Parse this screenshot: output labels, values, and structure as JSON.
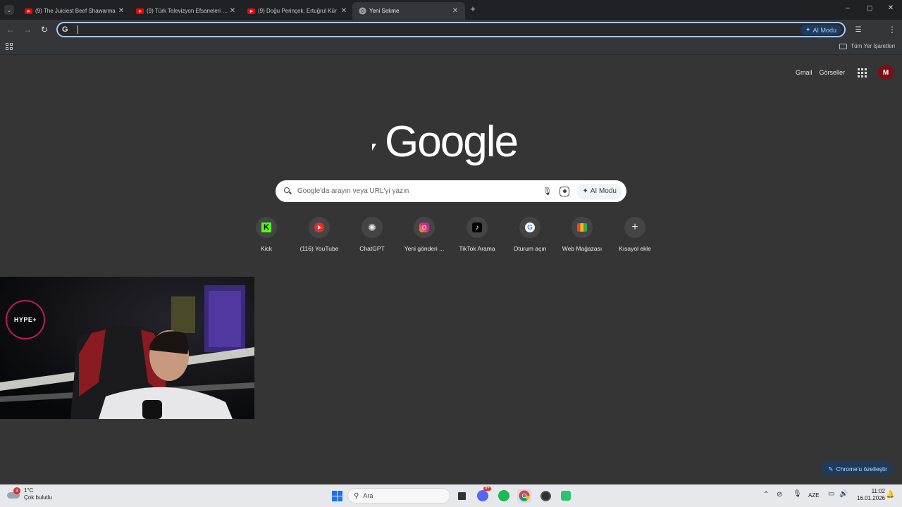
{
  "tabs": [
    {
      "title": "(9) The Juiciest Beef Shawarma",
      "favicon": "youtube-icon",
      "active": false
    },
    {
      "title": "(9) Türk Televizyon Efsaneleri Sp",
      "favicon": "youtube-icon",
      "active": false
    },
    {
      "title": "(9) Doğu Perinçek, Ertuğrul Kür",
      "favicon": "youtube-icon",
      "active": false
    },
    {
      "title": "Yeni Sekme",
      "favicon": "chrome-icon",
      "active": true
    }
  ],
  "omnibox": {
    "value": "",
    "ai_mode_label": "AI Modu"
  },
  "bookmarks": {
    "all_bookmarks_label": "Tüm Yer İşaretleri"
  },
  "ntp": {
    "gmail_link": "Gmail",
    "images_link": "Görseller",
    "logo_text": "Google",
    "search_placeholder": "Google'da arayın veya URL'yi yazın",
    "ai_mode_label": "AI Modu",
    "shortcuts": [
      {
        "label": "Kick",
        "icon": "kick-icon"
      },
      {
        "label": "(116) YouTube",
        "icon": "youtube-icon"
      },
      {
        "label": "ChatGPT",
        "icon": "chatgpt-icon"
      },
      {
        "label": "Yeni gönderi ...",
        "icon": "instagram-icon"
      },
      {
        "label": "TikTok Arama",
        "icon": "tiktok-icon"
      },
      {
        "label": "Oturum açın",
        "icon": "google-icon"
      },
      {
        "label": "Web Mağazası",
        "icon": "webstore-icon"
      },
      {
        "label": "Kısayol ekle",
        "icon": "plus-icon"
      }
    ],
    "customize_label": "Chrome'u özelleştir"
  },
  "webcam": {
    "badge_text": "HYPE+"
  },
  "taskbar": {
    "weather_temp": "1°C",
    "weather_desc": "Çok bulutlu",
    "weather_badge": "3",
    "search_placeholder": "Ara",
    "discord_badge": "9+",
    "language": "AZE",
    "time": "11:02",
    "date": "16.01.2026"
  },
  "colors": {
    "accent": "#a8c7fa",
    "bg": "#353535",
    "tabstrip": "#202124"
  }
}
